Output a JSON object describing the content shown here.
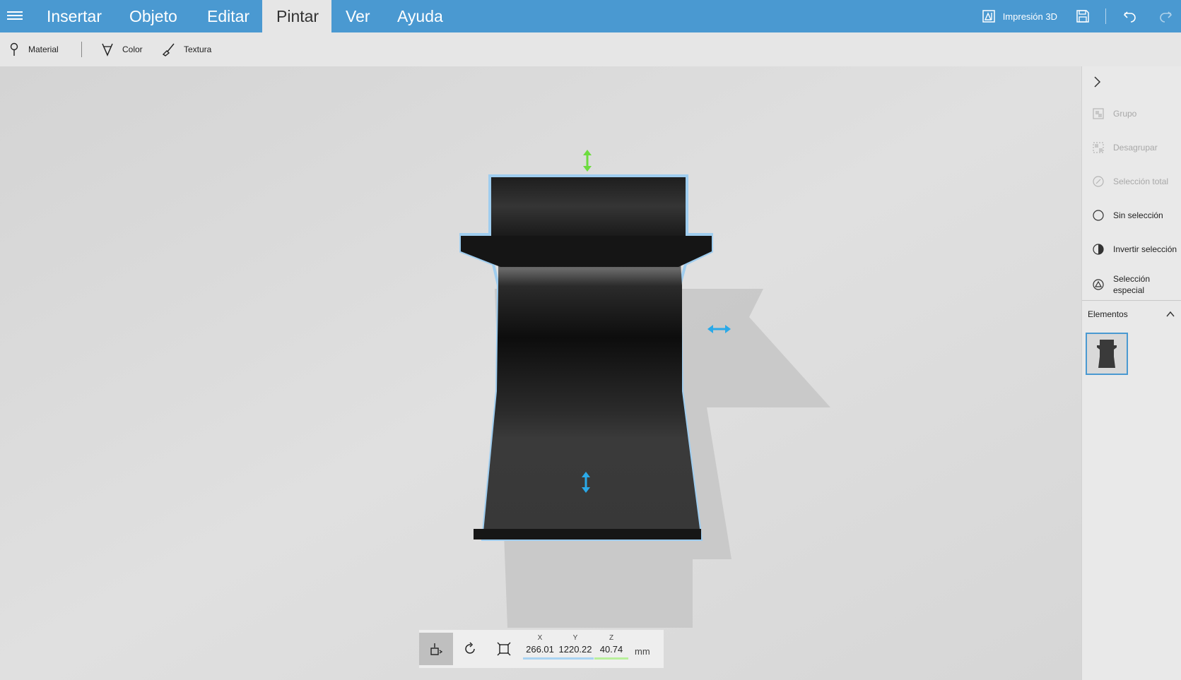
{
  "menubar": {
    "tabs": [
      {
        "label": "Insertar"
      },
      {
        "label": "Objeto"
      },
      {
        "label": "Editar"
      },
      {
        "label": "Pintar"
      },
      {
        "label": "Ver"
      },
      {
        "label": "Ayuda"
      }
    ],
    "active_tab": "Pintar",
    "print3d_label": "Impresión 3D"
  },
  "ribbon": {
    "material_label": "Material",
    "color_label": "Color",
    "texture_label": "Textura"
  },
  "sidepanel": {
    "items": [
      {
        "label": "Grupo",
        "enabled": false
      },
      {
        "label": "Desagrupar",
        "enabled": false
      },
      {
        "label": "Selección total",
        "enabled": false
      },
      {
        "label": "Sin selección",
        "enabled": true
      },
      {
        "label": "Invertir selección",
        "enabled": true
      },
      {
        "label": "Selección especial",
        "enabled": true
      }
    ],
    "elements_label": "Elementos"
  },
  "coords": {
    "x_label": "X",
    "x_value": "266.01",
    "y_label": "Y",
    "y_value": "1220.22",
    "z_label": "Z",
    "z_value": "40.74",
    "unit": "mm"
  },
  "colors": {
    "accent": "#4a99d1",
    "gizmo_green": "#6ddc3f",
    "gizmo_blue": "#2aa9e8",
    "object": "#2e2e2e"
  }
}
